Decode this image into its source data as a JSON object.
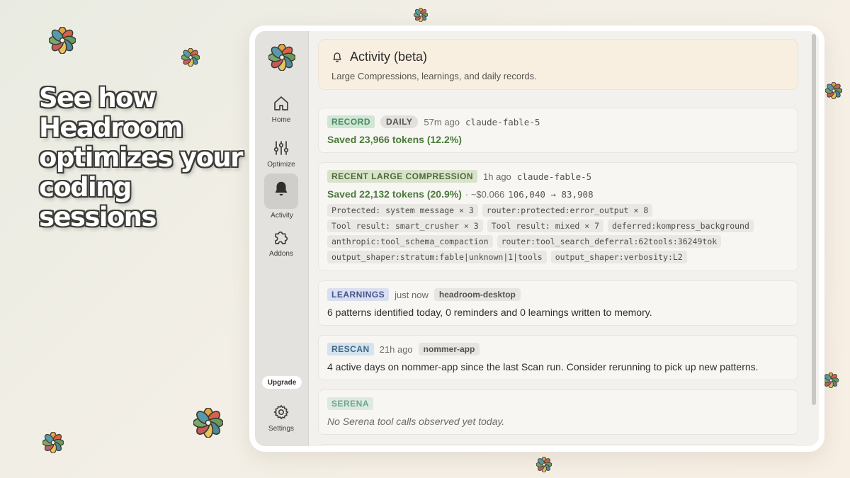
{
  "headline": "See how Headroom optimizes your coding sessions",
  "sidebar": {
    "items": [
      {
        "label": "Home",
        "icon": "home-icon"
      },
      {
        "label": "Optimize",
        "icon": "sliders-icon"
      },
      {
        "label": "Activity",
        "icon": "bell-icon"
      },
      {
        "label": "Addons",
        "icon": "puzzle-icon"
      }
    ],
    "upgrade_label": "Upgrade",
    "settings_label": "Settings"
  },
  "header": {
    "title": "Activity (beta)",
    "subtitle": "Large Compressions, learnings, and daily records."
  },
  "cards": {
    "record": {
      "badge": "RECORD",
      "period": "DAILY",
      "time": "57m ago",
      "model": "claude-fable-5",
      "saved": "Saved 23,966 tokens (12.2%)"
    },
    "compression": {
      "badge": "RECENT LARGE COMPRESSION",
      "time": "1h ago",
      "model": "claude-fable-5",
      "saved": "Saved 22,132 tokens (20.9%)",
      "cost": "· ~$0.066",
      "tokens": "106,040 → 83,908",
      "tags": [
        "Protected: system message × 3",
        "router:protected:error_output × 8",
        "Tool result: smart_crusher × 3",
        "Tool result: mixed × 7",
        "deferred:kompress_background",
        "anthropic:tool_schema_compaction",
        "router:tool_search_deferral:62tools:36249tok",
        "output_shaper:stratum:fable|unknown|1|tools",
        "output_shaper:verbosity:L2"
      ]
    },
    "learnings": {
      "badge": "LEARNINGS",
      "time": "just now",
      "project": "headroom-desktop",
      "text": "6 patterns identified today, 0 reminders and 0 learnings written to memory."
    },
    "rescan": {
      "badge": "RESCAN",
      "time": "21h ago",
      "project": "nommer-app",
      "text": "4 active days on nommer-app since the last Scan run. Consider rerunning to pick up new patterns."
    },
    "serena": {
      "badge": "SERENA",
      "text": "No Serena tool calls observed yet today."
    }
  },
  "colors": {
    "accent_green": "#4a7a3a",
    "record_badge": "#cfe6d5",
    "learnings_badge": "#d9dff0",
    "rescan_badge": "#d4e3ee",
    "header_bg": "#f8efe1"
  }
}
